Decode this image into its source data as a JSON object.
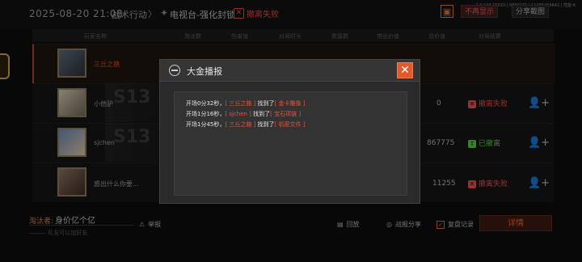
{
  "top": {
    "datetime": "2025-08-20 21:08",
    "mode": "战术行动",
    "chevron": "〉",
    "map": "电视台-强化封锁",
    "status": "撤离失败",
    "version": "1.0.193.15010 | 0890271 | 11465469642 | 性能-6",
    "btn1": "不再显示",
    "btn2": "分享截图"
  },
  "header": [
    "玩家名称",
    "淘汰数",
    "伤害值",
    "对局时长",
    "救援数",
    "带出价值",
    "总价值",
    "对局结算"
  ],
  "rows": [
    {
      "name": "三丘之貉",
      "score": "",
      "state": "",
      "state_type": "red",
      "highlight": true
    },
    {
      "name": "小他驴",
      "score": "0",
      "state": "撤离失败",
      "state_type": "red",
      "bg_text": "S13"
    },
    {
      "name": "sjchen",
      "score": "867775",
      "state": "已撤离",
      "state_type": "green",
      "bg_text": "S13"
    },
    {
      "name": "惑出什么你要...",
      "score": "11255",
      "state": "撤离失败",
      "state_type": "red"
    }
  ],
  "bottom": {
    "tag": "淘汰者:",
    "title": "身价亿个亿",
    "sub": "——— 队友可以加好友",
    "report": "举报",
    "replay": "回放",
    "share": "战报分享",
    "remember": "复盘记录",
    "detail": "详情"
  },
  "modal": {
    "title": "大金播报",
    "close": "✕",
    "lines": [
      {
        "time": "开场0分32秒，",
        "player": "[ 三丘之貉 ]",
        "found": " 找到了",
        "item": "[ 金卡雕像 ]"
      },
      {
        "time": "开场1分16秒，",
        "player": "[ sjchen ]",
        "found": " 找到了",
        "item": "[ 宝石项链 ]"
      },
      {
        "time": "开场1分45秒，",
        "player": "[ 三丘之貉 ]",
        "found": " 找到了",
        "item": "[ 机密文件 ]"
      }
    ]
  },
  "colors": {
    "accent": "#e05a2e",
    "red": "#e0504a",
    "green": "#5cc24a"
  }
}
